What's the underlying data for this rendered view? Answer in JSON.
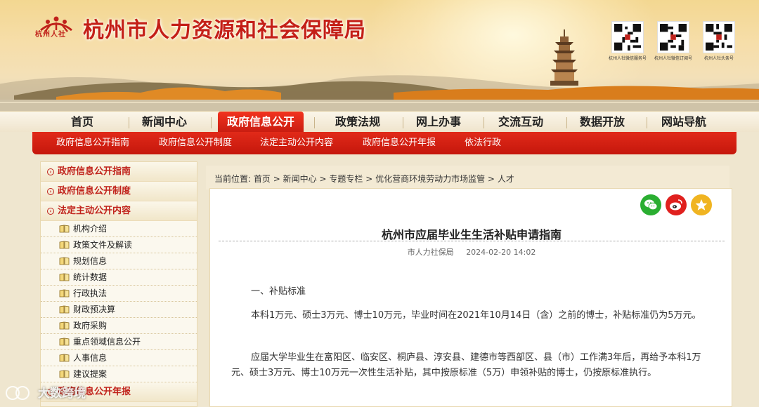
{
  "header": {
    "logo_text": "杭州人社",
    "site_title": "杭州市人力资源和社会保障局",
    "qr_captions": [
      "杭州人社微信服务号",
      "杭州人社微信订阅号",
      "杭州人社头条号"
    ]
  },
  "mainnav": {
    "items": [
      {
        "label": "首页"
      },
      {
        "label": "新闻中心"
      },
      {
        "label": "政府信息公开",
        "active": true
      },
      {
        "label": "政策法规"
      },
      {
        "label": "网上办事"
      },
      {
        "label": "交流互动"
      },
      {
        "label": "数据开放"
      },
      {
        "label": "网站导航"
      }
    ]
  },
  "subnav": {
    "items": [
      {
        "label": "政府信息公开指南"
      },
      {
        "label": "政府信息公开制度"
      },
      {
        "label": "法定主动公开内容"
      },
      {
        "label": "政府信息公开年报"
      },
      {
        "label": "依法行政"
      }
    ]
  },
  "sidebar": {
    "main_items": [
      {
        "label": "政府信息公开指南"
      },
      {
        "label": "政府信息公开制度"
      },
      {
        "label": "法定主动公开内容"
      }
    ],
    "sub_items": [
      {
        "label": "机构介绍"
      },
      {
        "label": "政策文件及解读"
      },
      {
        "label": "规划信息"
      },
      {
        "label": "统计数据"
      },
      {
        "label": "行政执法"
      },
      {
        "label": "财政预决算"
      },
      {
        "label": "政府采购"
      },
      {
        "label": "重点领域信息公开"
      },
      {
        "label": "人事信息"
      },
      {
        "label": "建议提案"
      }
    ],
    "last_item": "政府信息公开年报"
  },
  "breadcrumb": {
    "prefix": "当前位置:",
    "items": [
      "首页",
      "新闻中心",
      "专题专栏",
      "优化营商环境劳动力市场监管",
      "人才"
    ],
    "separator": ">"
  },
  "article": {
    "title": "杭州市应届毕业生生活补贴申请指南",
    "source": "市人力社保局",
    "date": "2024-02-20 14:02",
    "paragraphs": [
      "一、补贴标准",
      "本科1万元、硕士3万元、博士10万元，毕业时间在2021年10月14日（含）之前的博士，补贴标准仍为5万元。",
      "应届大学毕业生在富阳区、临安区、桐庐县、淳安县、建德市等西部区、县（市）工作满3年后，再给予本科1万元、硕士3万元、博士10万元一次性生活补贴，其中按原标准（5万）申领补贴的博士，仍按原标准执行。"
    ],
    "share_icons": [
      "wechat-icon",
      "weibo-icon",
      "favorite-icon"
    ]
  },
  "watermark": "大数跨境",
  "colors": {
    "brand_red": "#c41f17",
    "nav_red": "#d8220f",
    "wechat_green": "#2aae31",
    "weibo_red": "#e0201e",
    "star_gold": "#f0b421"
  }
}
